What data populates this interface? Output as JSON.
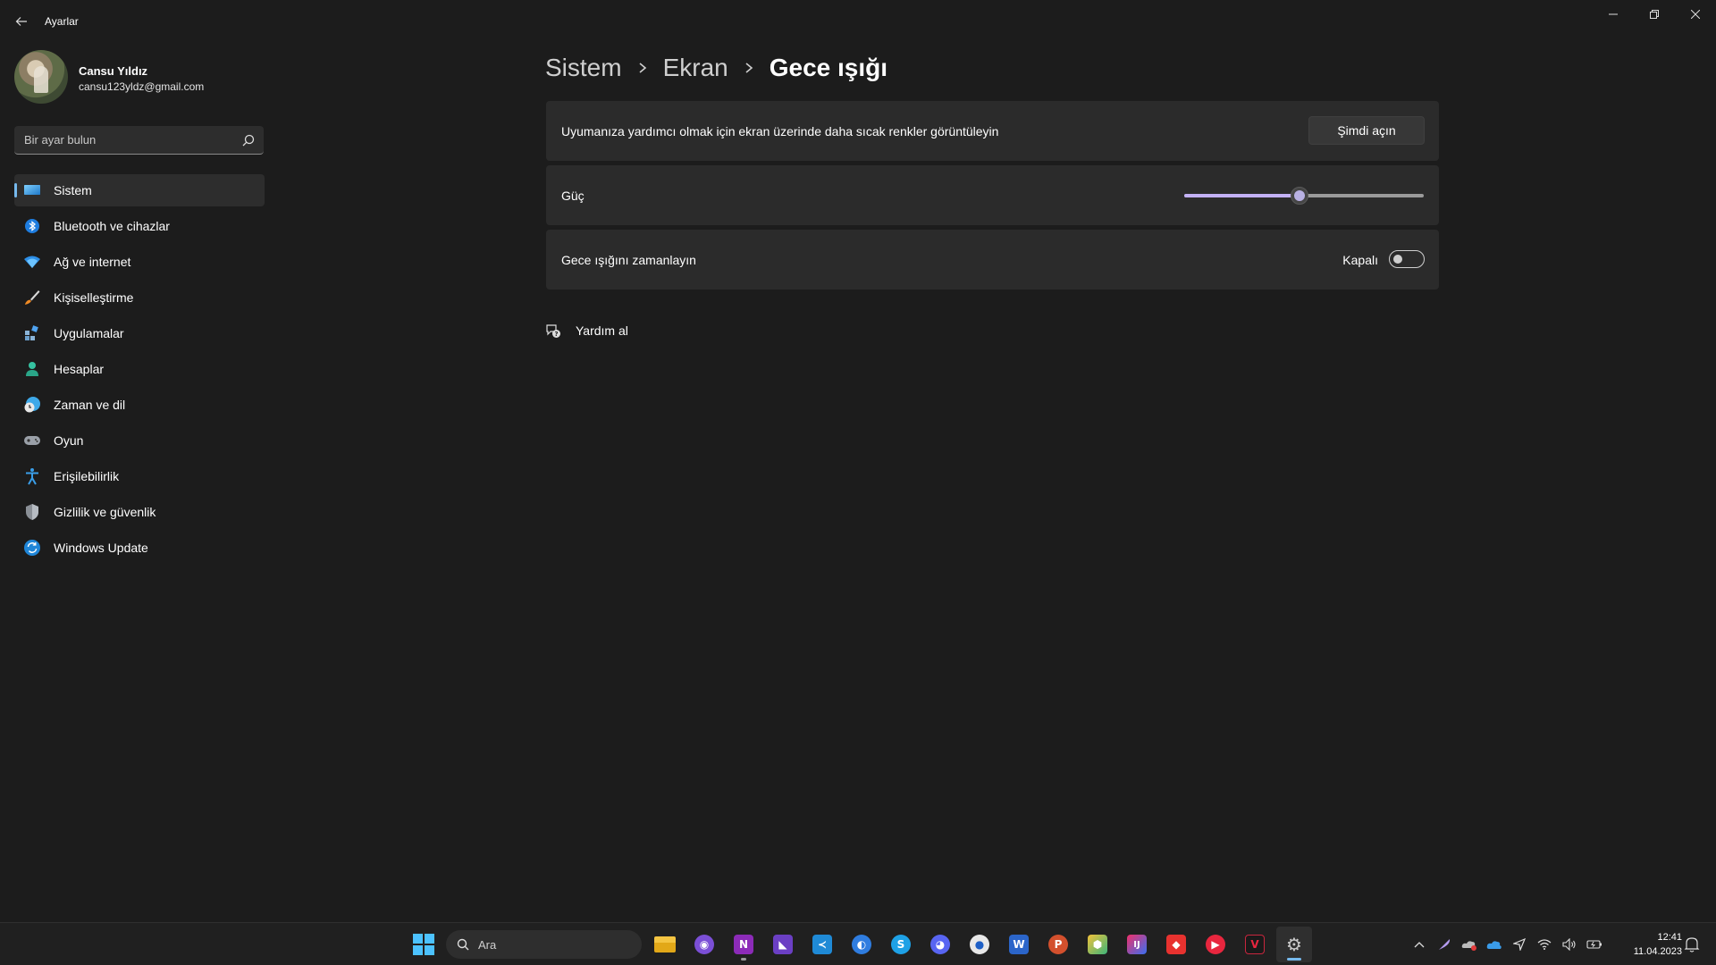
{
  "window": {
    "title": "Ayarlar"
  },
  "profile": {
    "name": "Cansu Yıldız",
    "email": "cansu123yldz@gmail.com"
  },
  "search": {
    "placeholder": "Bir ayar bulun"
  },
  "sidebar": {
    "items": [
      {
        "label": "Sistem",
        "icon": "system-display-icon",
        "active": true
      },
      {
        "label": "Bluetooth ve cihazlar",
        "icon": "bluetooth-icon"
      },
      {
        "label": "Ağ ve internet",
        "icon": "wifi-icon"
      },
      {
        "label": "Kişiselleştirme",
        "icon": "paintbrush-icon"
      },
      {
        "label": "Uygulamalar",
        "icon": "apps-icon"
      },
      {
        "label": "Hesaplar",
        "icon": "account-icon"
      },
      {
        "label": "Zaman ve dil",
        "icon": "globe-clock-icon"
      },
      {
        "label": "Oyun",
        "icon": "gamepad-icon"
      },
      {
        "label": "Erişilebilirlik",
        "icon": "accessibility-icon"
      },
      {
        "label": "Gizlilik ve güvenlik",
        "icon": "shield-icon"
      },
      {
        "label": "Windows Update",
        "icon": "update-icon"
      }
    ]
  },
  "breadcrumb": {
    "items": [
      "Sistem",
      "Ekran",
      "Gece ışığı"
    ]
  },
  "settings": {
    "turn_on_now": {
      "label": "Uyumanıza yardımcı olmak için ekran üzerinde daha sıcak renkler görüntüleyin",
      "button": "Şimdi açın"
    },
    "strength": {
      "label": "Güç",
      "value_fraction": 0.48
    },
    "schedule": {
      "label": "Gece ışığını zamanlayın",
      "state_label": "Kapalı",
      "enabled": false
    }
  },
  "help": {
    "label": "Yardım al"
  },
  "taskbar": {
    "search_label": "Ara",
    "apps": [
      {
        "name": "file-explorer-icon"
      },
      {
        "name": "github-desktop-icon"
      },
      {
        "name": "onenote-icon",
        "letter": "N"
      },
      {
        "name": "visual-studio-icon"
      },
      {
        "name": "vscode-icon"
      },
      {
        "name": "firefox-icon"
      },
      {
        "name": "skype-icon",
        "letter": "S"
      },
      {
        "name": "discord-icon"
      },
      {
        "name": "browser-icon"
      },
      {
        "name": "word-icon",
        "letter": "W"
      },
      {
        "name": "powerpoint-icon",
        "letter": "P"
      },
      {
        "name": "box-app-icon"
      },
      {
        "name": "intellij-icon",
        "letter": "IJ"
      },
      {
        "name": "anydesk-icon"
      },
      {
        "name": "media-player-icon"
      },
      {
        "name": "vivaldi-icon",
        "letter": "V"
      },
      {
        "name": "settings-gear-icon",
        "active": true
      }
    ],
    "clock_time": "12:41",
    "clock_date": "11.04.2023"
  },
  "colors": {
    "accent": "#76b9ed",
    "slider_fill": "#c3b1f5",
    "background": "#1c1c1c",
    "card": "#2b2b2b"
  }
}
